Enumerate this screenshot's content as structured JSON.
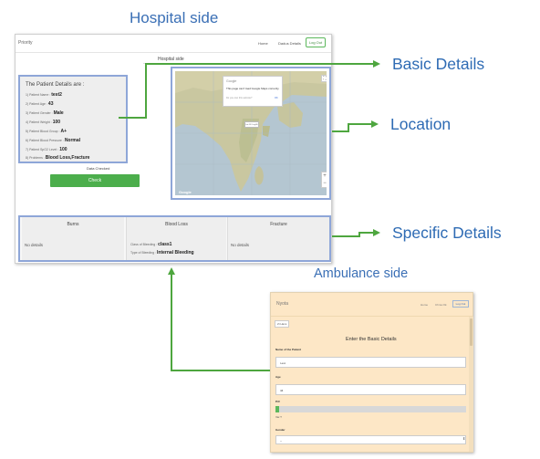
{
  "titles": {
    "hospital_side": "Hospital side",
    "ambulance_side": "Ambulance side"
  },
  "callouts": {
    "basic_details": "Basic Details",
    "location": "Location",
    "specific_details": "Specific Details"
  },
  "colors": {
    "callout_text": "#2e6bb4",
    "arrow": "#4ea63f",
    "highlight_border": "#8ea6d8",
    "primary_button": "#4cae4c",
    "ambulance_bg": "#fde7c6"
  },
  "hospital": {
    "brand": "Priority",
    "nav": {
      "home": "Home",
      "other": "Dadus Details",
      "logout": "Log Out"
    },
    "subtitle": "Hospital side",
    "patient_panel": {
      "title": "The Patient Details are :",
      "rows": [
        {
          "label": "1) Patient Name :",
          "value": "test2"
        },
        {
          "label": "2) Patient Age :",
          "value": "43"
        },
        {
          "label": "3) Patient Gender :",
          "value": "Male"
        },
        {
          "label": "4) Patient Weight :",
          "value": "100"
        },
        {
          "label": "5) Patient Blood Group :",
          "value": "A+"
        },
        {
          "label": "6) Patient Blood Pressure :",
          "value": "Normal"
        },
        {
          "label": "7) Patient SpO2 Level :",
          "value": "100"
        },
        {
          "label": "8) Problems :",
          "value": "Blood Loss,Fracture"
        }
      ]
    },
    "data_checked_label": "Data Checked",
    "check_button": "Check",
    "map": {
      "error_google": "Google",
      "error_line1": "This page can't load Google Maps correctly.",
      "error_line2": "Do you own this website?",
      "error_ok": "OK",
      "marker_label": "Lat:13 / Lng:80",
      "google_logo": "Google",
      "zoom_in": "+",
      "zoom_out": "−",
      "fullscreen": "⛶"
    },
    "specific": {
      "columns": [
        {
          "head": "Burns",
          "body": "No details"
        },
        {
          "head": "Blood Loss",
          "class_label": "Class of Bleeding :",
          "class_value": "class1",
          "type_label": "Type of Bleeding :",
          "type_value": "Internal Bleeding"
        },
        {
          "head": "Fracture",
          "body": "No details"
        }
      ]
    }
  },
  "ambulance": {
    "brand": "Nyota",
    "nav": {
      "home": "Home",
      "other": "Ch ka Ok",
      "logout": "Log Out"
    },
    "tab": "Zi Hans",
    "heading": "Enter the Basic Details",
    "fields": [
      {
        "label": "Name of the Patient",
        "value": "t.est."
      },
      {
        "label": "Age",
        "value": "44"
      }
    ],
    "progress_label": "P.R",
    "progress_value_fraction": 0.02,
    "progress_sub": "Var.T",
    "gender_label": "Gender",
    "gender_value": "--",
    "select_arrow": "⬍"
  }
}
